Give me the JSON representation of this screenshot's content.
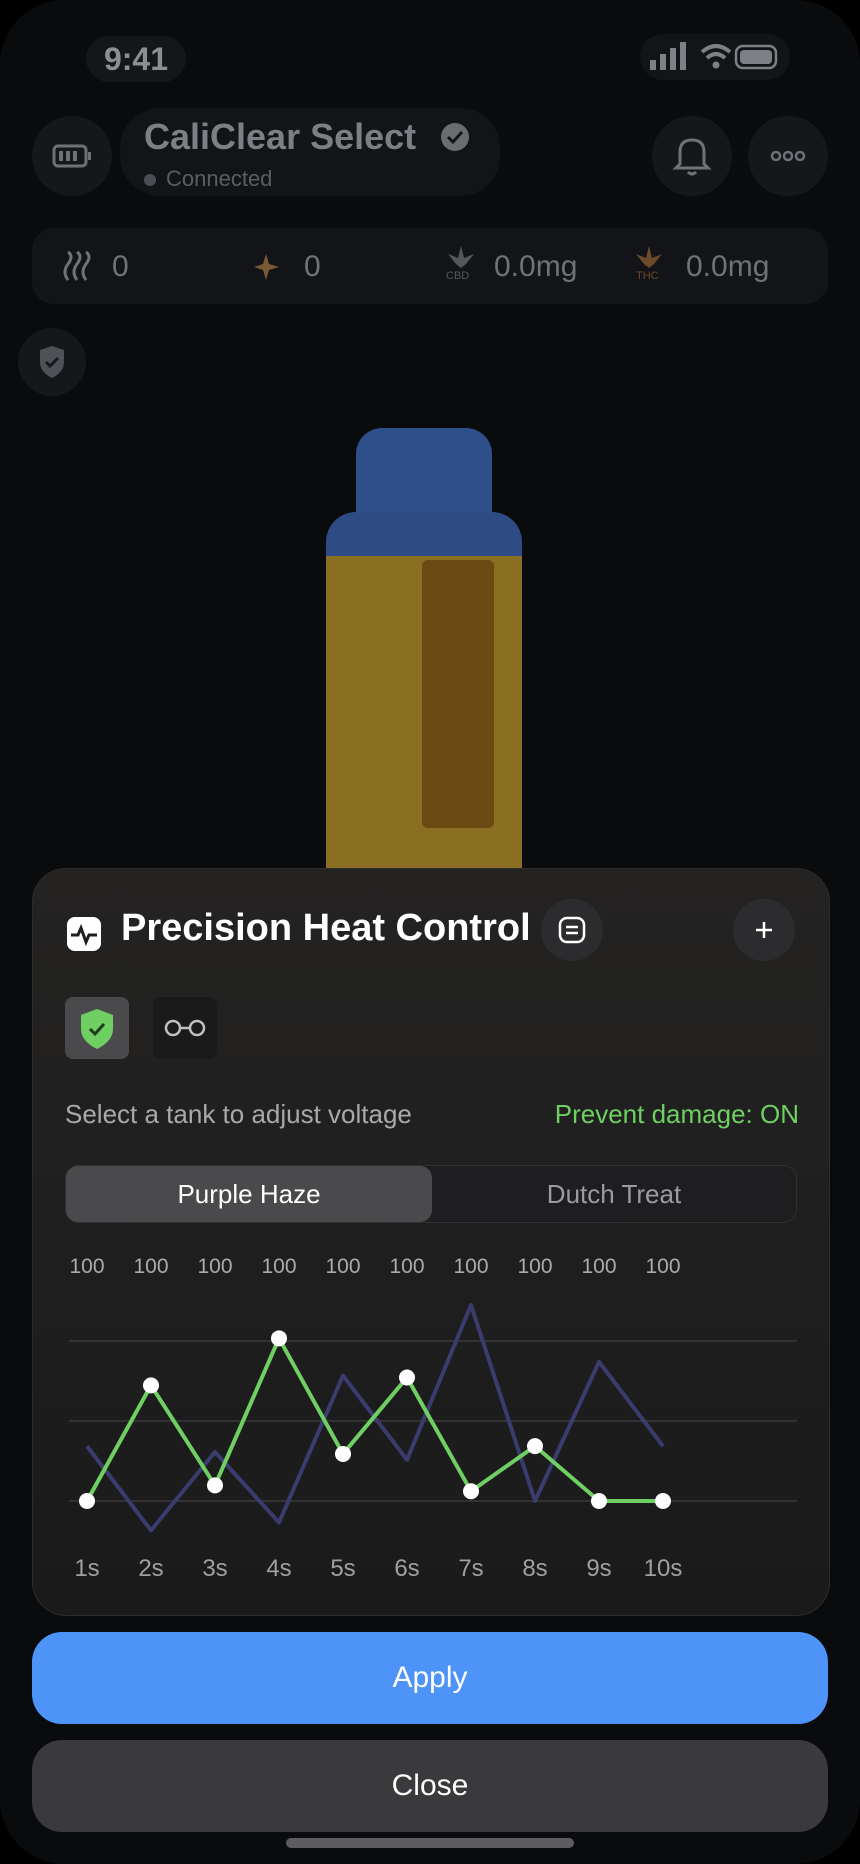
{
  "status_bar": {
    "time": "9:41"
  },
  "header": {
    "device_name": "CaliClear Select",
    "connection": "Connected"
  },
  "stats": [
    {
      "icon": "steam-icon",
      "value": "0"
    },
    {
      "icon": "sparkle-icon",
      "value": "0"
    },
    {
      "icon": "cbd-leaf-icon",
      "icon_label": "CBD",
      "value": "0.0mg"
    },
    {
      "icon": "thc-leaf-icon",
      "icon_label": "THC",
      "value": "0.0mg"
    }
  ],
  "sheet": {
    "title": "Precision Heat Control",
    "hint": "Select a tank to adjust voltage",
    "prevent_damage": "Prevent damage: ON",
    "tabs": [
      "Purple Haze",
      "Dutch Treat"
    ],
    "active_tab": "Purple Haze"
  },
  "colors": {
    "accent": "#4e93f8",
    "active_curve": "#6fcf63",
    "inactive_curve": "#3b3c6e",
    "prevent_text": "#6fcf63"
  },
  "chart_data": {
    "type": "line",
    "x": [
      "1s",
      "2s",
      "3s",
      "4s",
      "5s",
      "6s",
      "7s",
      "8s",
      "9s",
      "10s"
    ],
    "top_values": [
      "100",
      "100",
      "100",
      "100",
      "100",
      "100",
      "100",
      "100",
      "100",
      "100"
    ],
    "series": [
      {
        "name": "Purple Haze",
        "values": [
          0.0,
          0.59,
          0.08,
          0.83,
          0.24,
          0.63,
          0.05,
          0.28,
          0.0,
          0.0
        ]
      },
      {
        "name": "Dutch Treat",
        "values": [
          0.28,
          -0.15,
          0.25,
          -0.11,
          0.64,
          0.21,
          1.0,
          0.0,
          0.71,
          0.28
        ]
      }
    ]
  },
  "buttons": {
    "apply": "Apply",
    "close": "Close"
  }
}
